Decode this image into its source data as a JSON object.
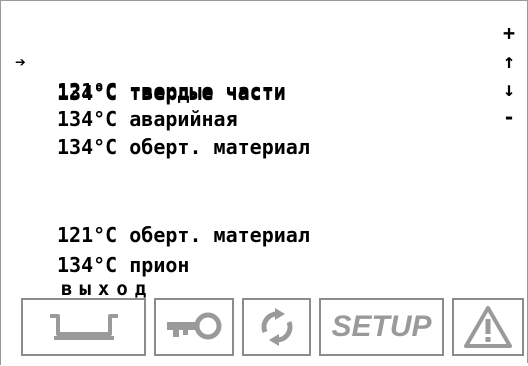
{
  "menu": {
    "cursor": "➔",
    "items": [
      {
        "label": "134°C твердые части"
      },
      {
        "label": "121°C твердые части"
      },
      {
        "label": "134°C аварийная"
      },
      {
        "label": "134°C оберт. материал"
      },
      {
        "label": "121°C оберт. материал"
      },
      {
        "label": "134°C прион"
      }
    ],
    "exit_label": "выход"
  },
  "side_controls": {
    "plus": "+",
    "up": "↑",
    "down": "↓",
    "minus": "-"
  },
  "toolbar": {
    "buttons": [
      {
        "icon": "tray-icon"
      },
      {
        "icon": "key-icon"
      },
      {
        "icon": "refresh-icon"
      },
      {
        "icon": "setup-icon",
        "label": "SETUP"
      },
      {
        "icon": "warning-icon"
      }
    ]
  },
  "colors": {
    "icon_gray": "#9a9a9a",
    "border_gray": "#8c8c8c",
    "text": "#000000",
    "background": "#ffffff"
  }
}
